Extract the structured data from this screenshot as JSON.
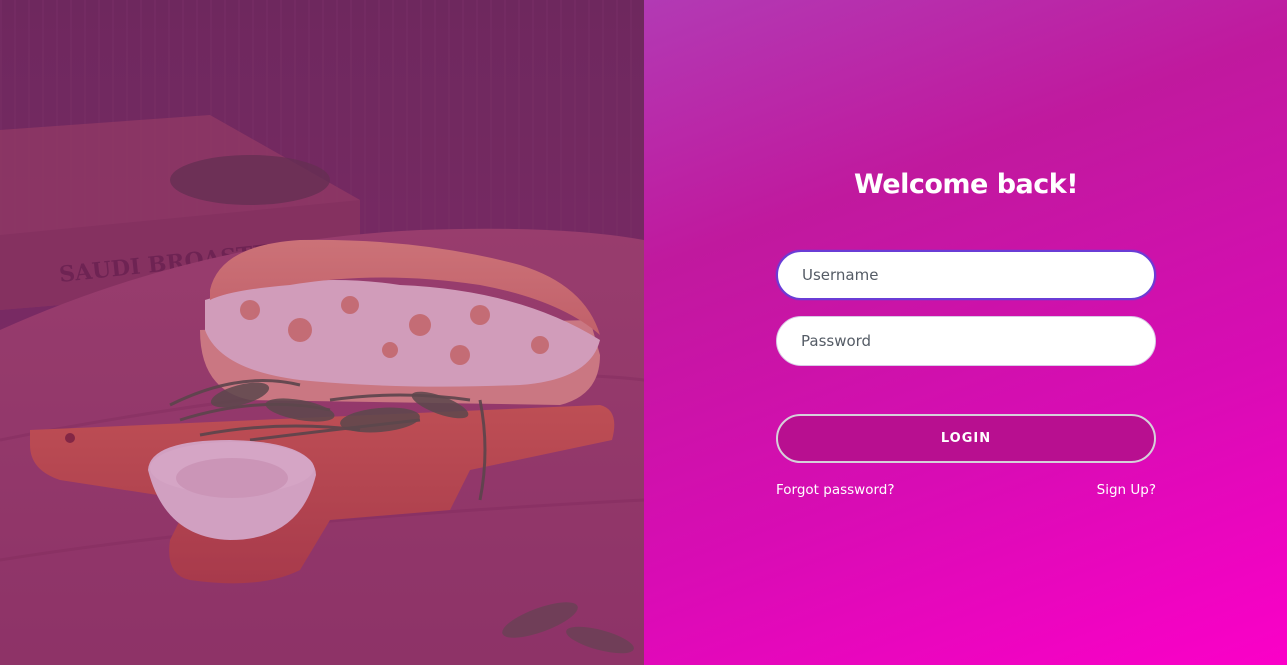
{
  "hero": {
    "image": "sandwich-on-cutting-board",
    "box_text": "SAUDI BROASTED"
  },
  "login": {
    "title": "Welcome back!",
    "username_placeholder": "Username",
    "password_placeholder": "Password",
    "login_label": "LOGIN",
    "forgot_label": "Forgot password?",
    "signup_label": "Sign Up?"
  },
  "colors": {
    "gradient_start": "#b23ab4",
    "gradient_end": "#fb00c8",
    "button_bg": "#b80f90",
    "focus_border": "#6a3cd6"
  }
}
